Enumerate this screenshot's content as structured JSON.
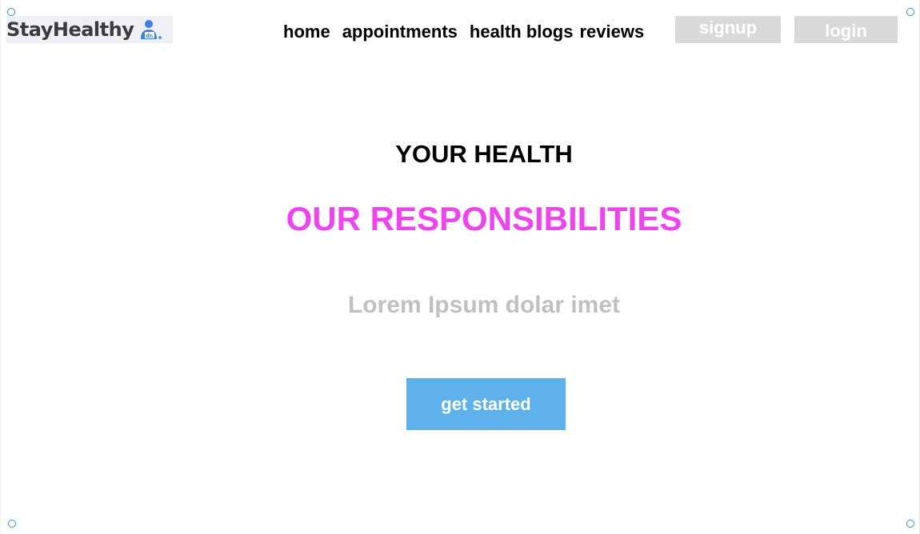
{
  "logo": {
    "text": "StayHealthy",
    "icon": "doctor-icon",
    "icon_text": "dr."
  },
  "nav": {
    "items": [
      {
        "label": "home"
      },
      {
        "label": "appointments"
      },
      {
        "label": "health blogs"
      },
      {
        "label": "reviews"
      }
    ],
    "signup_label": "signup",
    "login_label": "login"
  },
  "hero": {
    "line1": "YOUR HEALTH",
    "line2": "OUR RESPONSIBILITIES",
    "subtitle": "Lorem Ipsum dolar imet",
    "cta_label": "get started"
  },
  "colors": {
    "accent": "#ee44ee",
    "cta_bg": "#5eb1ea",
    "auth_button_bg": "#d9d9d9",
    "subtitle": "#c0c0c0",
    "logo_icon": "#3f7fe0"
  }
}
